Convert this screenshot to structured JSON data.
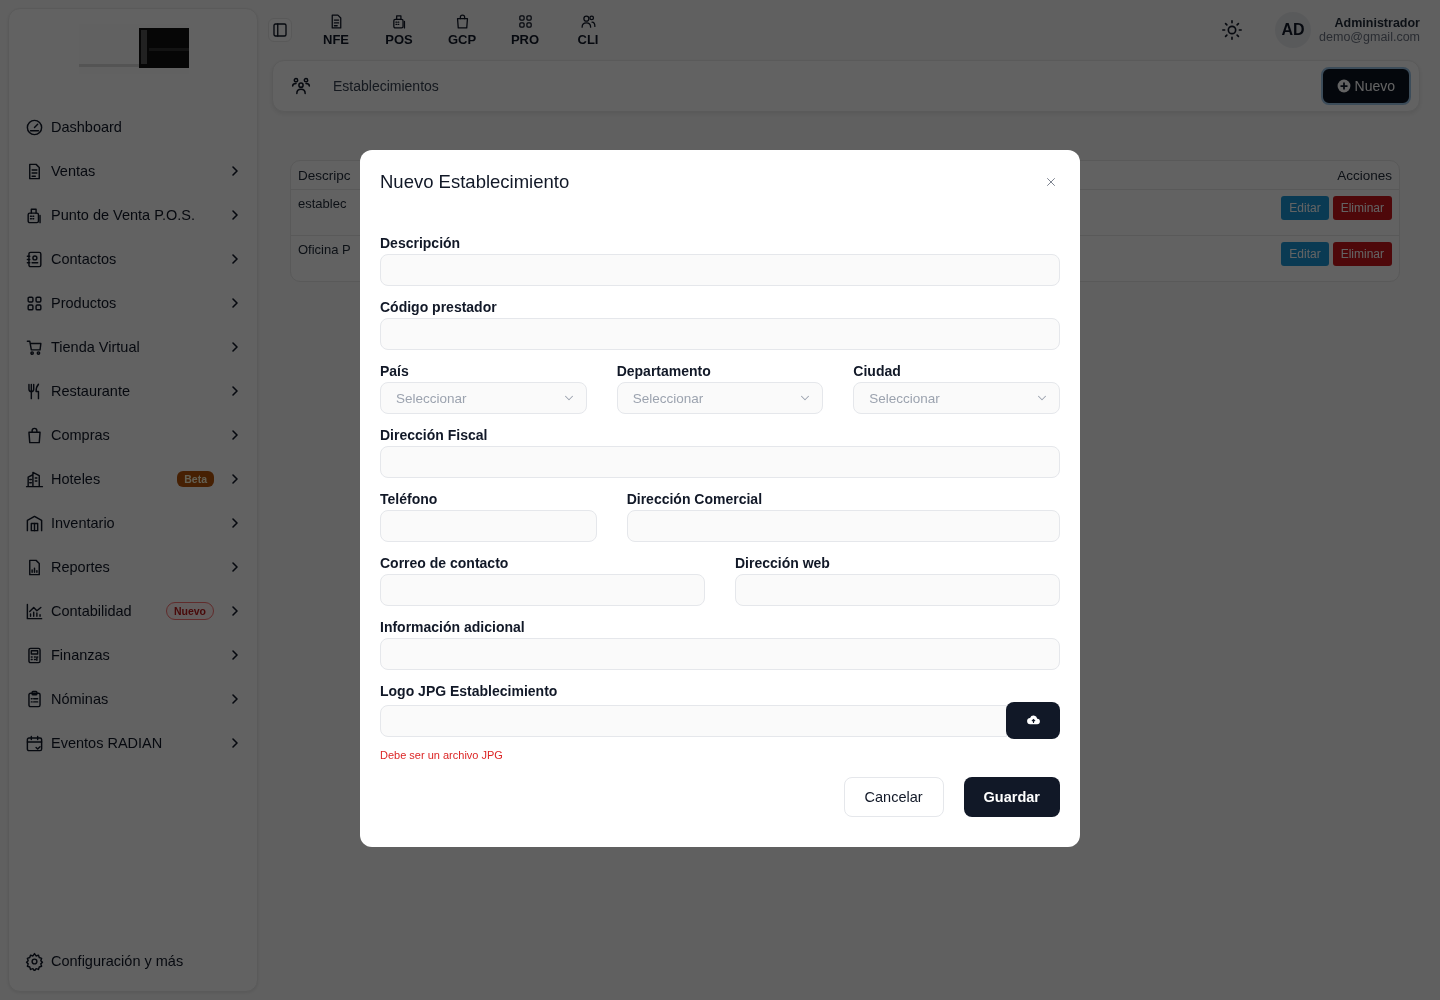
{
  "sidebar": {
    "items": [
      {
        "label": "Dashboard",
        "expandable": false
      },
      {
        "label": "Ventas",
        "expandable": true
      },
      {
        "label": "Punto de Venta P.O.S.",
        "expandable": true
      },
      {
        "label": "Contactos",
        "expandable": true
      },
      {
        "label": "Productos",
        "expandable": true
      },
      {
        "label": "Tienda Virtual",
        "expandable": true
      },
      {
        "label": "Restaurante",
        "expandable": true
      },
      {
        "label": "Compras",
        "expandable": true
      },
      {
        "label": "Hoteles",
        "expandable": true,
        "badge": {
          "text": "Beta",
          "kind": "beta"
        }
      },
      {
        "label": "Inventario",
        "expandable": true
      },
      {
        "label": "Reportes",
        "expandable": true
      },
      {
        "label": "Contabilidad",
        "expandable": true,
        "badge": {
          "text": "Nuevo",
          "kind": "new"
        }
      },
      {
        "label": "Finanzas",
        "expandable": true
      },
      {
        "label": "Nóminas",
        "expandable": true
      },
      {
        "label": "Eventos RADIAN",
        "expandable": true
      }
    ],
    "footer": "Configuración y más"
  },
  "top_nav": [
    "NFE",
    "POS",
    "GCP",
    "PRO",
    "CLI"
  ],
  "user": {
    "initials": "AD",
    "name": "Administrador",
    "email": "demo@gmail.com"
  },
  "page_header": {
    "title": "Establecimientos",
    "new_button": "Nuevo"
  },
  "table": {
    "columns": [
      "Descripc",
      "Acciones"
    ],
    "rows": [
      {
        "cell": "establec",
        "edit": "Editar",
        "delete": "Eliminar"
      },
      {
        "cell": "Oficina P",
        "edit": "Editar",
        "delete": "Eliminar"
      }
    ]
  },
  "modal": {
    "title": "Nuevo Establecimiento",
    "rows": [
      [
        {
          "label": "Descripción",
          "kind": "input"
        }
      ],
      [
        {
          "label": "Código prestador",
          "kind": "input"
        }
      ],
      [
        {
          "label": "País",
          "kind": "select",
          "placeholder": "Seleccionar"
        },
        {
          "label": "Departamento",
          "kind": "select",
          "placeholder": "Seleccionar"
        },
        {
          "label": "Ciudad",
          "kind": "select",
          "placeholder": "Seleccionar"
        }
      ],
      [
        {
          "label": "Dirección Fiscal",
          "kind": "input"
        }
      ],
      [
        {
          "label": "Teléfono",
          "kind": "input"
        },
        {
          "label": "Dirección Comercial",
          "kind": "input"
        }
      ],
      [
        {
          "label": "Correo de contacto",
          "kind": "input"
        },
        {
          "label": "Dirección web",
          "kind": "input"
        }
      ],
      [
        {
          "label": "Información adicional",
          "kind": "input"
        }
      ],
      [
        {
          "label": "Logo JPG Establecimiento",
          "kind": "file",
          "hint": "Debe ser un archivo JPG"
        }
      ]
    ],
    "cancel": "Cancelar",
    "save": "Guardar"
  }
}
